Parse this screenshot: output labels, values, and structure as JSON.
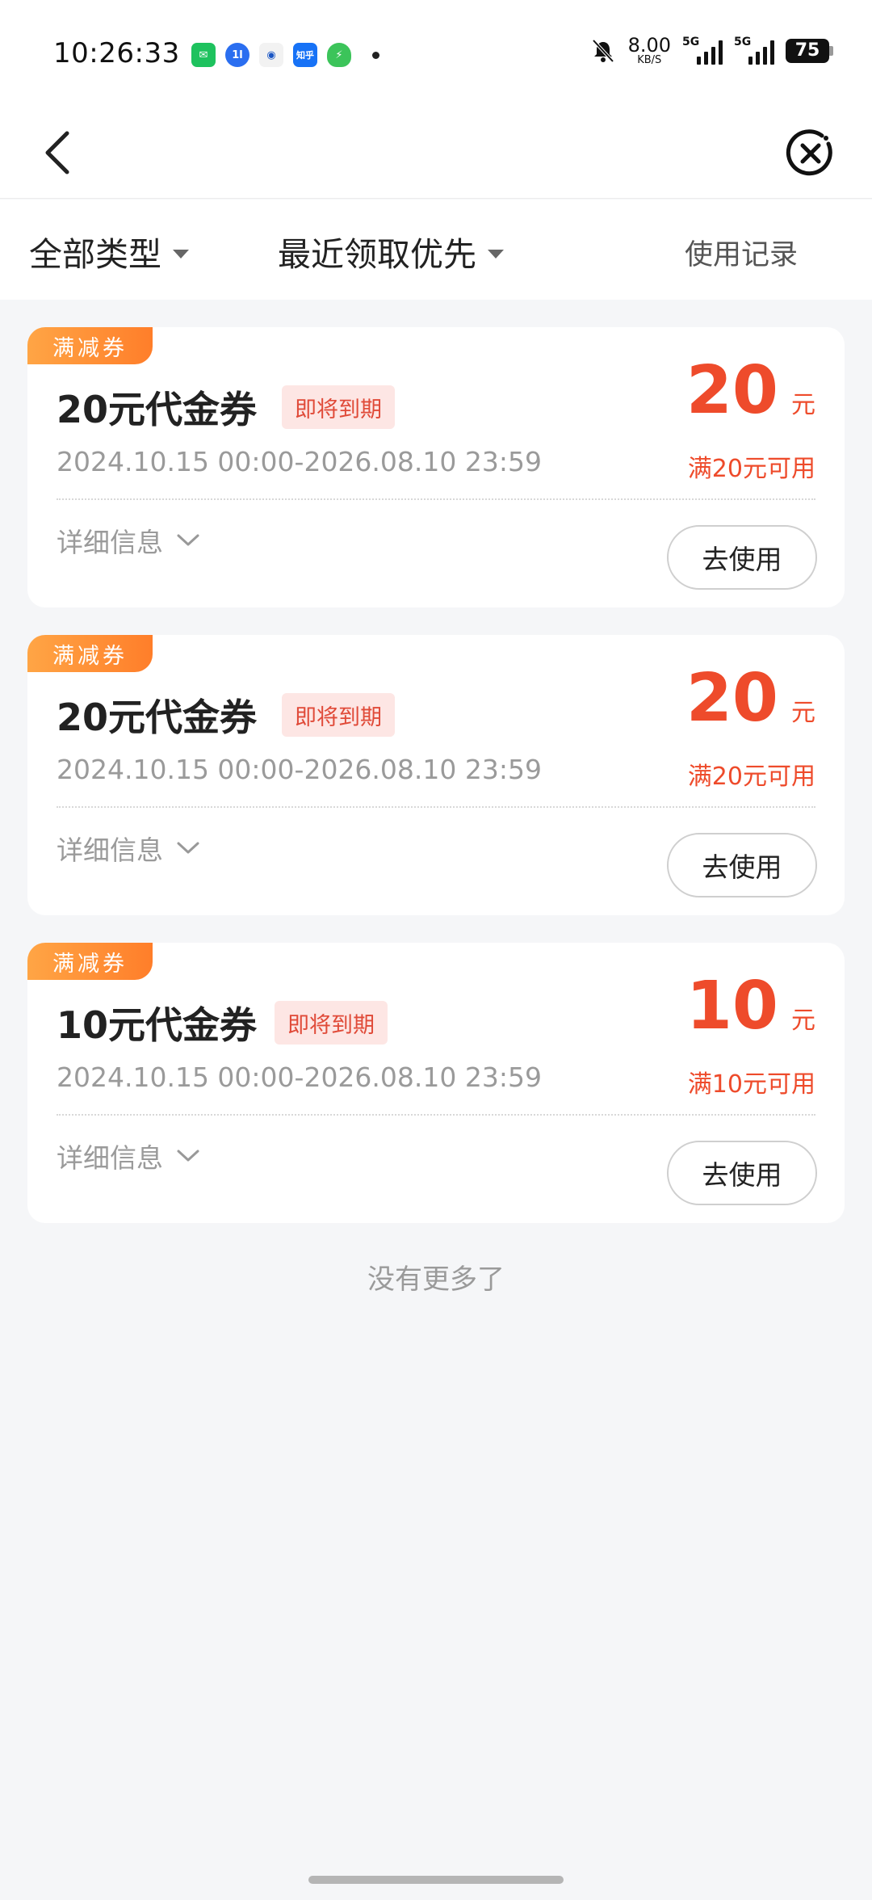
{
  "status_bar": {
    "time": "10:26:33",
    "apps": [
      {
        "name": "wechat-icon",
        "color": "#1ec25e",
        "glyph": "✉"
      },
      {
        "name": "app-icon-1",
        "color": "#2a6ef0",
        "glyph": "1l"
      },
      {
        "name": "app-icon-bank",
        "color": "#f2f2f2",
        "glyph": "◉"
      },
      {
        "name": "zhihu-icon",
        "color": "#1772f6",
        "glyph": "知乎"
      },
      {
        "name": "security-icon",
        "color": "#3cc45a",
        "glyph": "⚡"
      }
    ],
    "net_speed_value": "8.00",
    "net_speed_unit": "KB/S",
    "signal_label_1": "5G",
    "signal_label_2": "5G",
    "battery": "75"
  },
  "filters": {
    "type_label": "全部类型",
    "sort_label": "最近领取优先",
    "records_label": "使用记录"
  },
  "coupons": [
    {
      "tag": "满减券",
      "title": "20元代金券",
      "badge": "即将到期",
      "validity": "2024.10.15 00:00-2026.08.10 23:59",
      "amount": "20",
      "unit": "元",
      "condition": "满20元可用",
      "details": "详细信息",
      "action": "去使用"
    },
    {
      "tag": "满减券",
      "title": "20元代金券",
      "badge": "即将到期",
      "validity": "2024.10.15 00:00-2026.08.10 23:59",
      "amount": "20",
      "unit": "元",
      "condition": "满20元可用",
      "details": "详细信息",
      "action": "去使用"
    },
    {
      "tag": "满减券",
      "title": "10元代金券",
      "badge": "即将到期",
      "validity": "2024.10.15 00:00-2026.08.10 23:59",
      "amount": "10",
      "unit": "元",
      "condition": "满10元可用",
      "details": "详细信息",
      "action": "去使用"
    }
  ],
  "footer": {
    "no_more": "没有更多了"
  },
  "colors": {
    "accent": "#ee4b2b",
    "tag_gradient_start": "#ffa545",
    "tag_gradient_end": "#ff7e2a",
    "badge_bg": "#fde6e4"
  }
}
